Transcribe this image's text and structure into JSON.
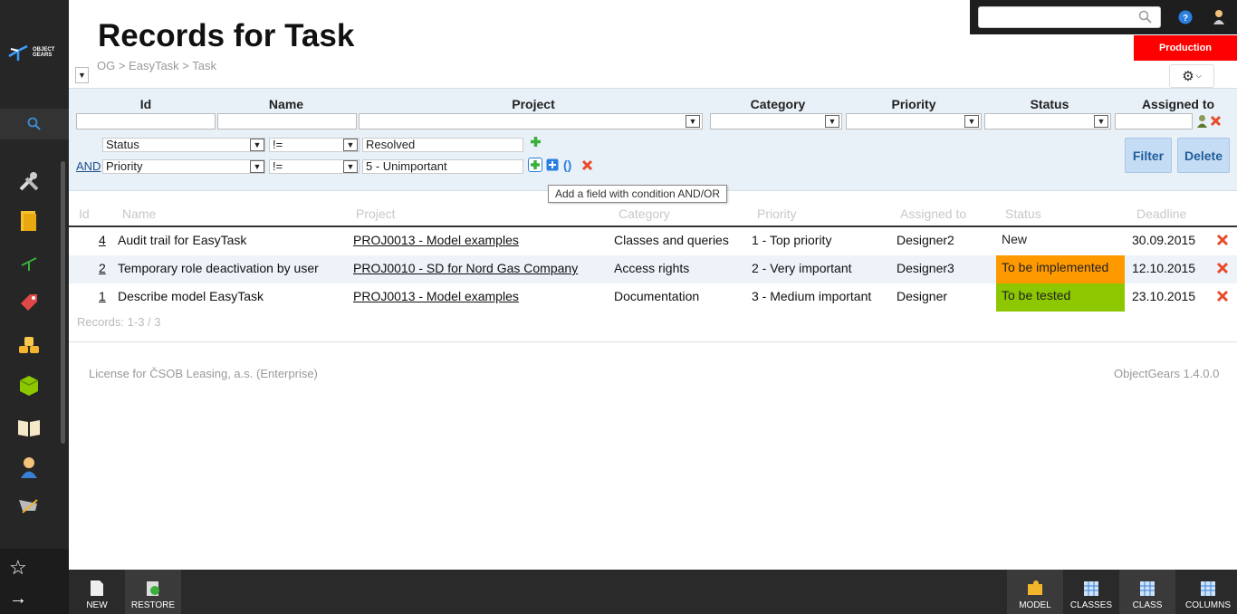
{
  "app": {
    "logo_line1": "OBJECT",
    "logo_line2": "GEARS"
  },
  "header": {
    "title": "Records for Task",
    "breadcrumb": "OG > EasyTask > Task",
    "env_badge": "Production"
  },
  "search": {
    "value": ""
  },
  "filter": {
    "columns": [
      "Id",
      "Name",
      "Project",
      "Category",
      "Priority",
      "Status",
      "Assigned to"
    ],
    "conditions": [
      {
        "connector": "",
        "field": "Status",
        "operator": "!=",
        "value": "Resolved"
      },
      {
        "connector": "AND",
        "field": "Priority",
        "operator": "!=",
        "value": "5 - Unimportant"
      }
    ],
    "filter_label": "Filter",
    "delete_label": "Delete",
    "tooltip": "Add a field with condition AND/OR",
    "paren_label": "()"
  },
  "grid": {
    "headers": [
      "Id",
      "Name",
      "Project",
      "Category",
      "Priority",
      "Assigned to",
      "Status",
      "Deadline"
    ],
    "rows": [
      {
        "id": "4",
        "name": "Audit trail for EasyTask",
        "project": "PROJ0013 - Model examples",
        "category": "Classes and queries",
        "priority": "1 - Top priority",
        "assigned": "Designer2",
        "status": "New",
        "status_color": "",
        "deadline": "30.09.2015"
      },
      {
        "id": "2",
        "name": "Temporary role deactivation by user",
        "project": "PROJ0010 - SD for Nord Gas Company",
        "category": "Access rights",
        "priority": "2 - Very important",
        "assigned": "Designer3",
        "status": "To be implemented",
        "status_color": "#ff9900",
        "deadline": "12.10.2015"
      },
      {
        "id": "1",
        "name": "Describe model EasyTask",
        "project": "PROJ0013 - Model examples",
        "category": "Documentation",
        "priority": "3 - Medium important",
        "assigned": "Designer",
        "status": "To be tested",
        "status_color": "#8cc700",
        "deadline": "23.10.2015"
      }
    ],
    "records": "Records: 1-3 / 3"
  },
  "footer": {
    "license": "License for ČSOB Leasing, a.s. (Enterprise)",
    "version": "ObjectGears 1.4.0.0"
  },
  "bottombar": {
    "new": "NEW",
    "restore": "RESTORE",
    "model": "MODEL",
    "classes": "CLASSES",
    "class": "CLASS",
    "columns": "COLUMNS"
  },
  "colors": {
    "production": "#ff0000",
    "filter_bg": "#e8f0f8",
    "sidebar": "#262626"
  }
}
